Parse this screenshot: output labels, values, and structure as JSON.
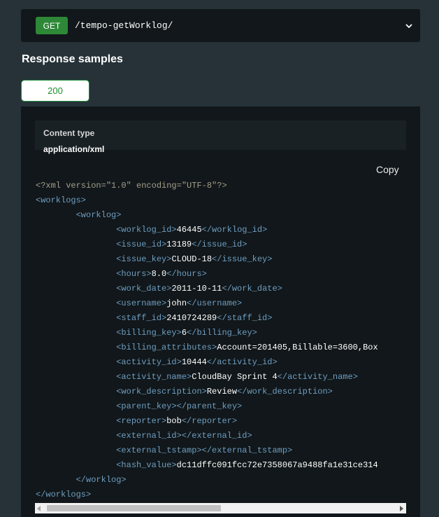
{
  "endpoint": {
    "method": "GET",
    "path": "/tempo-getWorklog/",
    "toggle_icon": "chevron-down-icon"
  },
  "section": {
    "title": "Response samples"
  },
  "status_tab": {
    "label": "200"
  },
  "content_type": {
    "label": "Content type",
    "value": "application/xml"
  },
  "copy_label": "Copy",
  "code_lines": [
    {
      "indent": "",
      "parts": [
        [
          "decl",
          "<?xml version=\"1.0\" encoding=\"UTF-8\"?>"
        ]
      ]
    },
    {
      "indent": "",
      "parts": [
        [
          "tag",
          "<worklogs>"
        ]
      ]
    },
    {
      "indent": "        ",
      "parts": [
        [
          "tag",
          "<worklog>"
        ]
      ]
    },
    {
      "indent": "                ",
      "parts": [
        [
          "tag",
          "<worklog_id>"
        ],
        [
          "val",
          "46445"
        ],
        [
          "tag",
          "</worklog_id>"
        ]
      ]
    },
    {
      "indent": "                ",
      "parts": [
        [
          "tag",
          "<issue_id>"
        ],
        [
          "val",
          "13189"
        ],
        [
          "tag",
          "</issue_id>"
        ]
      ]
    },
    {
      "indent": "                ",
      "parts": [
        [
          "tag",
          "<issue_key>"
        ],
        [
          "val",
          "CLOUD-18"
        ],
        [
          "tag",
          "</issue_key>"
        ]
      ]
    },
    {
      "indent": "                ",
      "parts": [
        [
          "tag",
          "<hours>"
        ],
        [
          "val",
          "8.0"
        ],
        [
          "tag",
          "</hours>"
        ]
      ]
    },
    {
      "indent": "                ",
      "parts": [
        [
          "tag",
          "<work_date>"
        ],
        [
          "val",
          "2011-10-11"
        ],
        [
          "tag",
          "</work_date>"
        ]
      ]
    },
    {
      "indent": "                ",
      "parts": [
        [
          "tag",
          "<username>"
        ],
        [
          "val",
          "john"
        ],
        [
          "tag",
          "</username>"
        ]
      ]
    },
    {
      "indent": "                ",
      "parts": [
        [
          "tag",
          "<staff_id>"
        ],
        [
          "val",
          "2410724289"
        ],
        [
          "tag",
          "</staff_id>"
        ]
      ]
    },
    {
      "indent": "                ",
      "parts": [
        [
          "tag",
          "<billing_key>"
        ],
        [
          "val",
          "6"
        ],
        [
          "tag",
          "</billing_key>"
        ]
      ]
    },
    {
      "indent": "                ",
      "parts": [
        [
          "tag",
          "<billing_attributes>"
        ],
        [
          "val",
          "Account=201405,Billable=3600,Box"
        ]
      ]
    },
    {
      "indent": "                ",
      "parts": [
        [
          "tag",
          "<activity_id>"
        ],
        [
          "val",
          "10444"
        ],
        [
          "tag",
          "</activity_id>"
        ]
      ]
    },
    {
      "indent": "                ",
      "parts": [
        [
          "tag",
          "<activity_name>"
        ],
        [
          "val",
          "CloudBay Sprint 4"
        ],
        [
          "tag",
          "</activity_name>"
        ]
      ]
    },
    {
      "indent": "                ",
      "parts": [
        [
          "tag",
          "<work_description>"
        ],
        [
          "val",
          "Review"
        ],
        [
          "tag",
          "</work_description>"
        ]
      ]
    },
    {
      "indent": "                ",
      "parts": [
        [
          "tag",
          "<parent_key>"
        ],
        [
          "tag",
          "</parent_key>"
        ]
      ]
    },
    {
      "indent": "                ",
      "parts": [
        [
          "tag",
          "<reporter>"
        ],
        [
          "val",
          "bob"
        ],
        [
          "tag",
          "</reporter>"
        ]
      ]
    },
    {
      "indent": "                ",
      "parts": [
        [
          "tag",
          "<external_id>"
        ],
        [
          "tag",
          "</external_id>"
        ]
      ]
    },
    {
      "indent": "                ",
      "parts": [
        [
          "tag",
          "<external_tstamp>"
        ],
        [
          "tag",
          "</external_tstamp>"
        ]
      ]
    },
    {
      "indent": "                ",
      "parts": [
        [
          "tag",
          "<hash_value>"
        ],
        [
          "val",
          "dc11dffc091fcc72e7358067a9488fa1e31ce314"
        ]
      ]
    },
    {
      "indent": "        ",
      "parts": [
        [
          "tag",
          "</worklog>"
        ]
      ]
    },
    {
      "indent": "",
      "parts": [
        [
          "tag",
          "</worklogs>"
        ]
      ]
    }
  ],
  "colors": {
    "background": "#263238",
    "panel": "#11171a",
    "accent_green": "#2d8937",
    "tag": "#6f9ec2",
    "decl": "#a49f8a"
  }
}
